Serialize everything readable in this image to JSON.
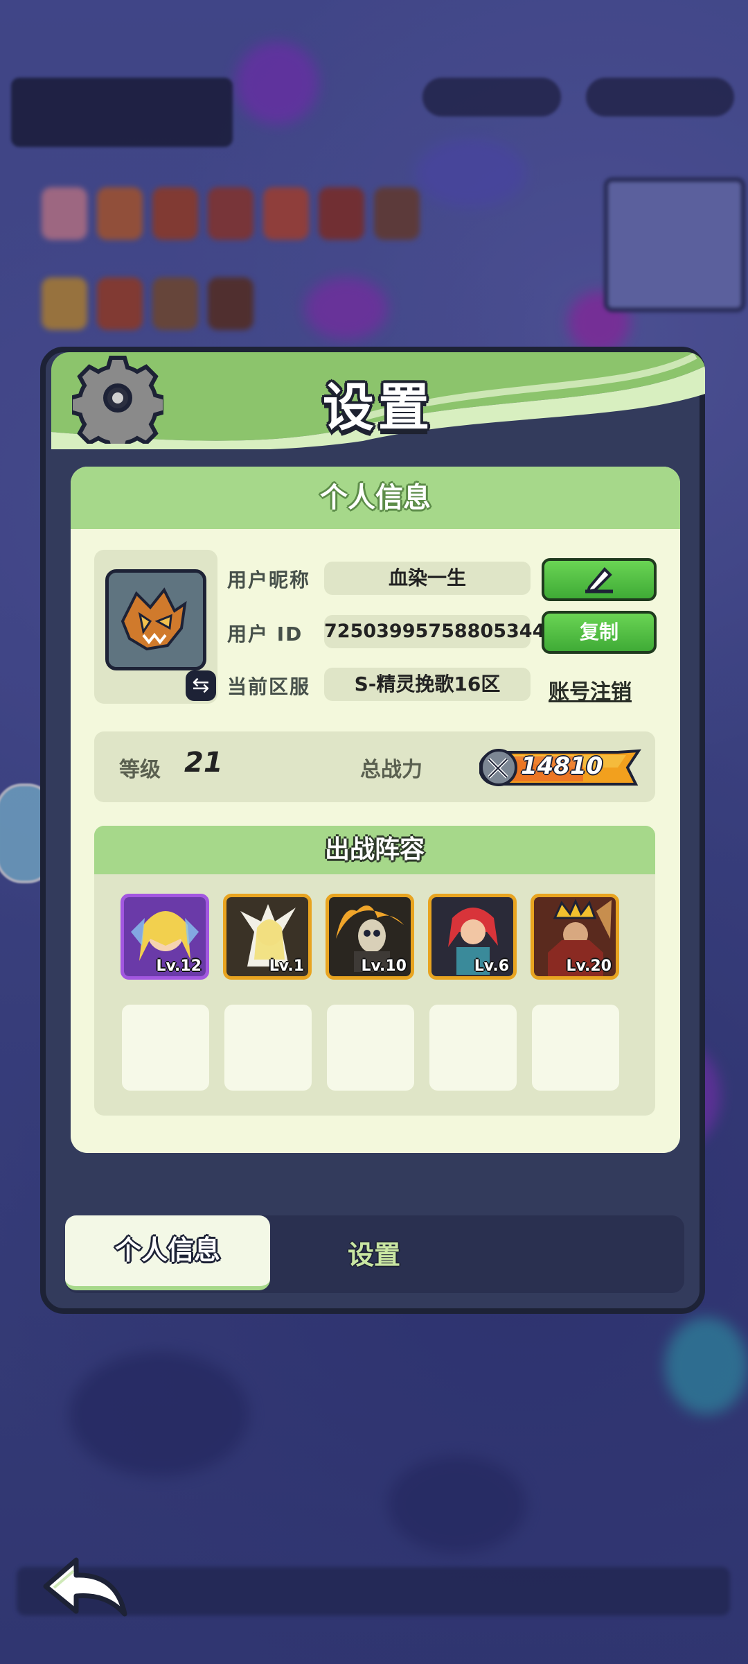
{
  "panel": {
    "title": "设置",
    "section_title": "个人信息"
  },
  "profile": {
    "nickname_label": "用户昵称",
    "nickname_value": "血染一生",
    "userid_label": "用户 ID",
    "userid_value": "72503995758805344",
    "server_label": "当前区服",
    "server_value": "S-精灵挽歌16区",
    "copy_button": "复制",
    "cancel_account_link": "账号注销"
  },
  "stats": {
    "level_label": "等级",
    "level_value": "21",
    "power_label": "总战力",
    "power_value": "14810"
  },
  "lineup": {
    "title": "出战阵容",
    "heroes": [
      {
        "level": "Lv.12",
        "rarity": "purple"
      },
      {
        "level": "Lv.1",
        "rarity": "gold"
      },
      {
        "level": "Lv.10",
        "rarity": "gold"
      },
      {
        "level": "Lv.6",
        "rarity": "gold"
      },
      {
        "level": "Lv.20",
        "rarity": "gold"
      }
    ]
  },
  "tabs": {
    "active": "个人信息",
    "inactive": "设置"
  },
  "colors": {
    "panel_bg": "#333b5c",
    "accent_green": "#a6d88a",
    "button_green": "#4fbf42"
  }
}
